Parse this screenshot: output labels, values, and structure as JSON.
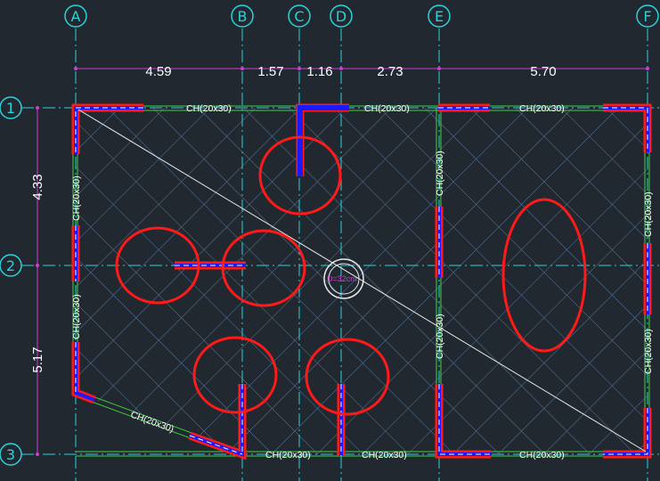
{
  "grid": {
    "columns": [
      "A",
      "B",
      "C",
      "D",
      "E",
      "F"
    ],
    "rows": [
      "1",
      "2",
      "3"
    ]
  },
  "dimensions": {
    "horizontal": [
      "4.59",
      "1.57",
      "1.16",
      "2.73",
      "5.70"
    ],
    "vertical": [
      "4.33",
      "5.17"
    ]
  },
  "beams": {
    "label": "CH(20x30)"
  },
  "hole": {
    "label": "D=32cm"
  },
  "colors": {
    "background": "#212830",
    "gridline": "#29d3dc",
    "dimension": "#d13bd6",
    "beam": "#3fcf3f",
    "wall": "#ff1a1a",
    "wall_core": "#1a1aff",
    "hatch": "#5a7ca8",
    "annotation": "#ff1a1a"
  }
}
